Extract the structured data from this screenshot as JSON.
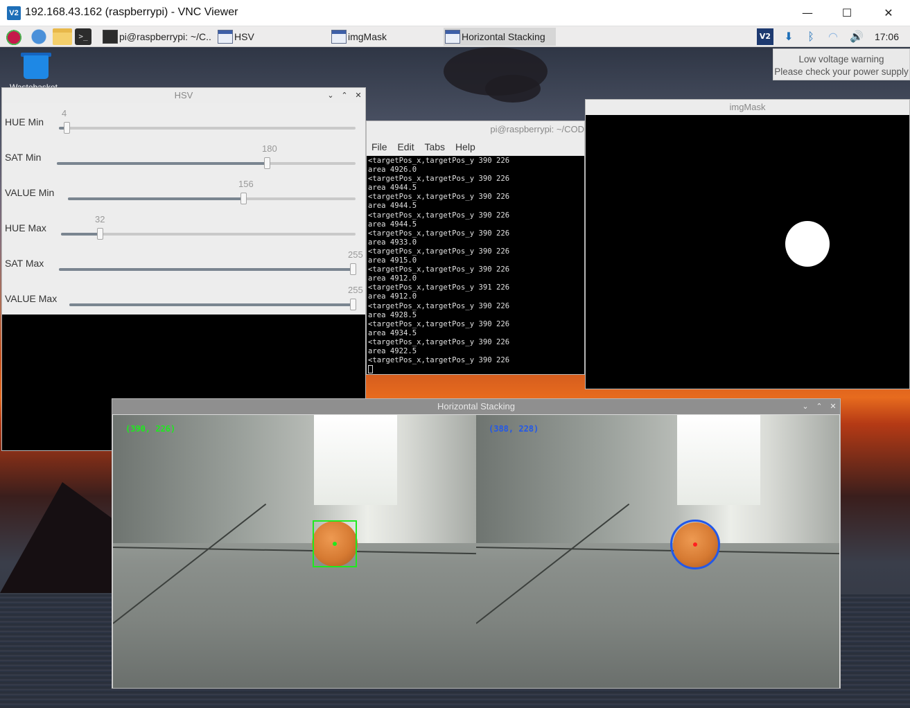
{
  "vnc": {
    "logo": "V2",
    "title": "192.168.43.162 (raspberrypi) - VNC Viewer",
    "controls": {
      "minimize": "—",
      "maximize": "☐",
      "close": "✕"
    }
  },
  "taskbar": {
    "tasks": [
      {
        "label": "pi@raspberrypi: ~/C...",
        "icon": "terminal-icon"
      },
      {
        "label": "HSV",
        "icon": "window-icon"
      },
      {
        "label": "imgMask",
        "icon": "window-icon"
      },
      {
        "label": "Horizontal Stacking",
        "icon": "window-icon"
      }
    ],
    "tray_vnc": "V2",
    "clock": "17:06"
  },
  "notification": {
    "line1": "Low voltage warning",
    "line2": "Please check your power supply"
  },
  "desktop": {
    "trash_label": "Wastebasket"
  },
  "hsv_window": {
    "title": "HSV",
    "sliders": [
      {
        "label": "HUE Min",
        "value": "4",
        "max": 255
      },
      {
        "label": "SAT Min",
        "value": "180",
        "max": 255
      },
      {
        "label": "VALUE Min",
        "value": "156",
        "max": 255
      },
      {
        "label": "HUE Max",
        "value": "32",
        "max": 255
      },
      {
        "label": "SAT Max",
        "value": "255",
        "max": 255
      },
      {
        "label": "VALUE Max",
        "value": "255",
        "max": 255
      }
    ]
  },
  "terminal": {
    "title": "pi@raspberrypi: ~/COD",
    "menu": [
      "File",
      "Edit",
      "Tabs",
      "Help"
    ],
    "lines": [
      "<targetPos_x,targetPos_y 390 226",
      "area 4926.0",
      "<targetPos_x,targetPos_y 390 226",
      "area 4944.5",
      "<targetPos_x,targetPos_y 390 226",
      "area 4944.5",
      "<targetPos_x,targetPos_y 390 226",
      "area 4944.5",
      "<targetPos_x,targetPos_y 390 226",
      "area 4933.0",
      "<targetPos_x,targetPos_y 390 226",
      "area 4915.0",
      "<targetPos_x,targetPos_y 390 226",
      "area 4912.0",
      "<targetPos_x,targetPos_y 391 226",
      "area 4912.0",
      "<targetPos_x,targetPos_y 390 226",
      "area 4928.5",
      "<targetPos_x,targetPos_y 390 226",
      "area 4934.5",
      "<targetPos_x,targetPos_y 390 226",
      "area 4922.5",
      "<targetPos_x,targetPos_y 390 226"
    ]
  },
  "imgmask_window": {
    "title": "imgMask"
  },
  "stacking_window": {
    "title": "Horizontal Stacking",
    "left_coord": "(390, 226)",
    "right_coord": "(388, 228)",
    "colors": {
      "box": "#1eea1e",
      "circle": "#2358e8",
      "left_coord": "#1eea1e",
      "right_coord": "#2358e8",
      "left_center": "#1eea1e",
      "right_center": "#ff2020"
    }
  },
  "window_buttons": {
    "minimize": "⌄",
    "maximize": "⌃",
    "close": "✕"
  }
}
